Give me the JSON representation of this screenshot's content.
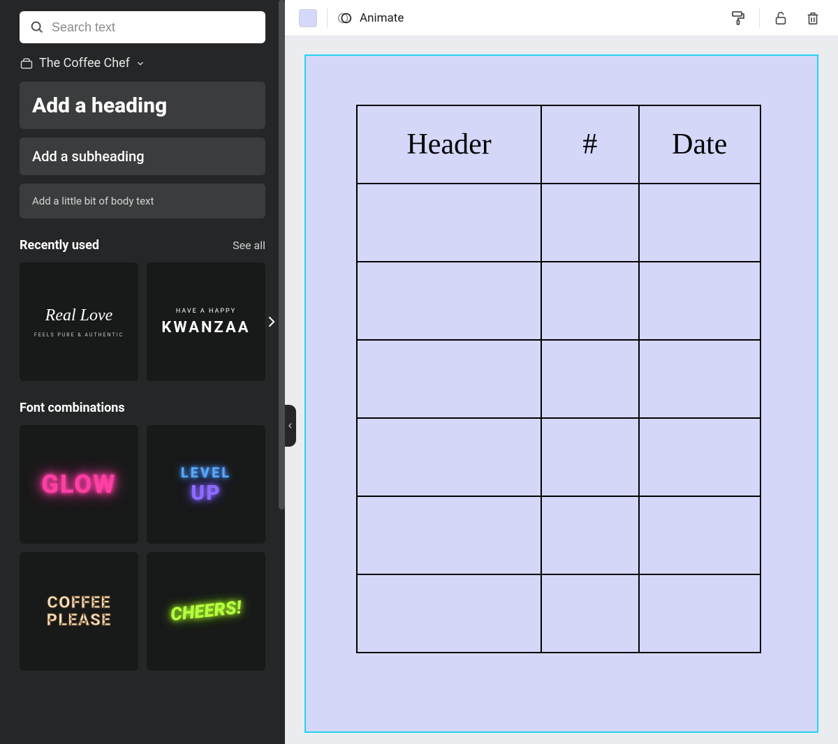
{
  "sidebar": {
    "search_placeholder": "Search text",
    "brand_label": "The Coffee Chef",
    "heading_button": "Add a heading",
    "subheading_button": "Add a subheading",
    "body_button": "Add a little bit of body text",
    "recent_title": "Recently used",
    "see_all": "See all",
    "recent_items": [
      {
        "top": "Real Love",
        "sub": "FEELS PURE & AUTHENTIC"
      },
      {
        "top": "HAVE A HAPPY",
        "main": "KWANZAA"
      }
    ],
    "combo_title": "Font combinations",
    "combo_items": [
      {
        "label": "GLOW"
      },
      {
        "top": "LEVEL",
        "bot": "UP"
      },
      {
        "line1": "COFFEE",
        "line2": "PLEASE"
      },
      {
        "label": "CHEERS!"
      }
    ]
  },
  "topbar": {
    "swatch_color": "#d5d7fb",
    "animate_label": "Animate"
  },
  "canvas": {
    "table_headers": [
      "Header",
      "#",
      "Date"
    ],
    "body_rows": 6
  }
}
